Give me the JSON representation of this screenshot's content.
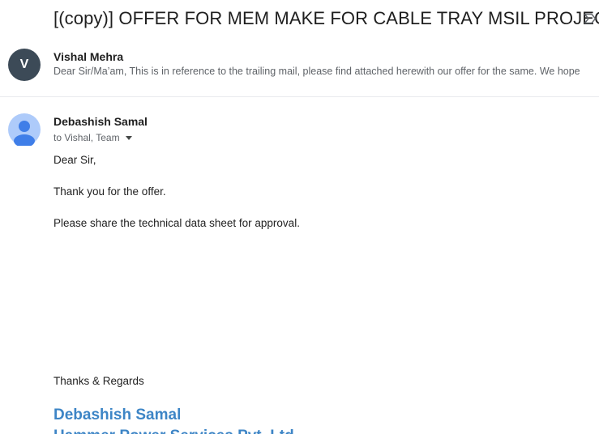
{
  "thread": {
    "subject": "[(copy)] OFFER FOR MEM MAKE FOR CABLE TRAY MSIL PROJECT",
    "important_icon": "important-marker-icon"
  },
  "messages": [
    {
      "state": "collapsed",
      "avatar_letter": "V",
      "avatar_color": "#3c4a57",
      "sender": "Vishal Mehra",
      "snippet": "Dear Sir/Ma’am, This is in reference to the trailing mail, please find attached herewith our offer for the same. We hope"
    },
    {
      "state": "expanded",
      "avatar_icon": "default-person-icon",
      "sender": "Debashish Samal",
      "recipients": "to Vishal, Team",
      "body": [
        "Dear Sir,",
        "Thank you for the offer.",
        "Please share the technical data sheet for approval."
      ],
      "closing": "Thanks & Regards",
      "signature_name": "Debashish Samal",
      "signature_company": "Hammer Power Services Pvt. Ltd."
    }
  ],
  "colors": {
    "signature": "#3d85c6",
    "divider": "#e8eaed",
    "secondary_text": "#5f6368"
  }
}
